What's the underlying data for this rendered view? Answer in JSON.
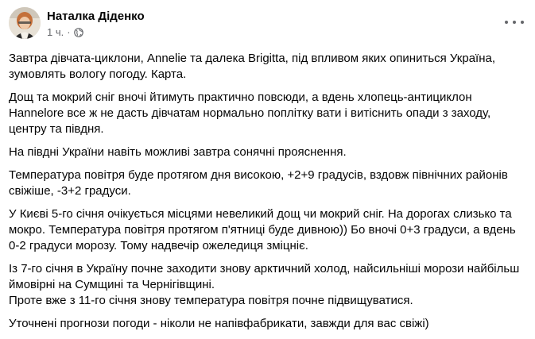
{
  "post": {
    "author": "Наталка Діденко",
    "time": "1 ч.",
    "dot": "·",
    "audience_icon": "globe-icon",
    "more_icon": "more-options-icon",
    "paragraphs": [
      {
        "lines": [
          "Завтра дівчата-циклони, Annelie та далека Brigitta, під впливом яких опиниться Україна,",
          "зумовлять вологу погоду. Карта."
        ]
      },
      {
        "lines": [
          "Дощ та мокрий сніг вночі йтимуть практично повсюди, а вдень хлопець-антициклон",
          "Hannelore все ж не дасть дівчатам нормально поплітку вати і витіснить опади з заходу,",
          "центру та півдня."
        ]
      },
      {
        "lines": [
          "На півдні України навіть можливі завтра сонячні прояснення."
        ]
      },
      {
        "lines": [
          "Температура повітря буде протягом дня високою, +2+9 градусів, вздовж північних районів",
          "свіжіше, -3+2 градуси."
        ]
      },
      {
        "lines": [
          "У Києві 5-го січня очікується місцями невеликий дощ чи мокрий сніг. На дорогах слизько та",
          "мокро. Температура повітря протягом п'ятниці буде дивною)) Бо вночі 0+3 градуси, а вдень",
          "0-2 градуси морозу. Тому надвечір ожеледиця зміцніє."
        ]
      },
      {
        "lines": [
          "Із 7-го січня в Україну почне заходити знову арктичний холод, найсильніші морози найбільш",
          "ймовірні на Сумщині та Чернігівщині.",
          "Проте вже з 11-го  січня знову температура повітря почне підвищуватися."
        ]
      },
      {
        "lines": [
          "Уточнені прогнози погоди - ніколи не напівфабрикати, завжди для вас свіжі)"
        ]
      }
    ]
  }
}
